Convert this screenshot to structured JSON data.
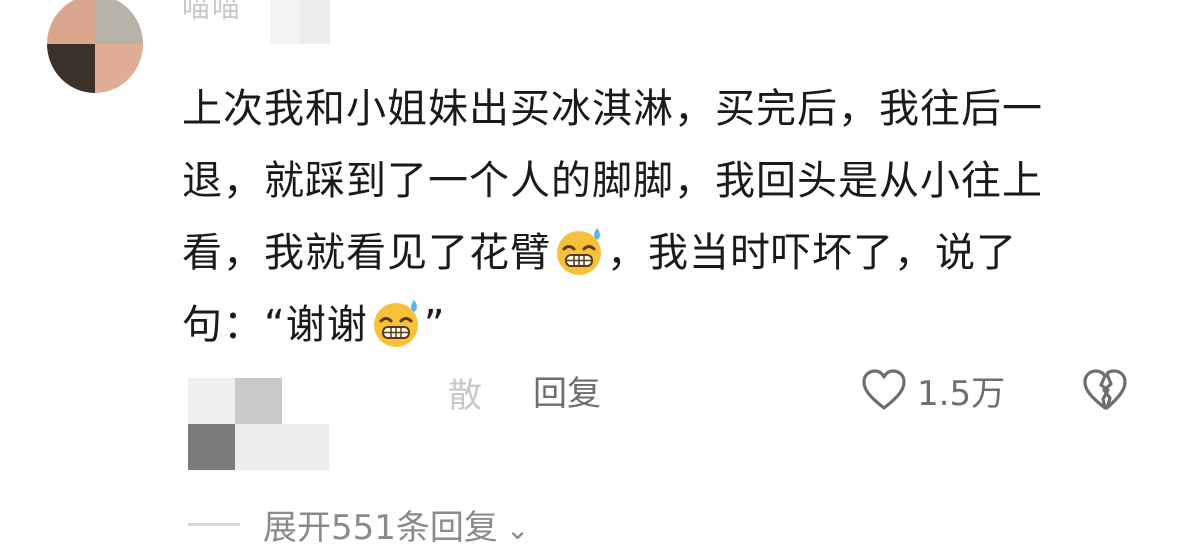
{
  "comment": {
    "username": "喵喵",
    "lines": [
      {
        "text": "上次我和小姐妹出买冰淇淋，买完后，我往后一"
      },
      {
        "text": "退，就踩到了一个人的脚脚，我回头是从小往上"
      },
      {
        "before": "看，我就看见了花臂",
        "emoji": "grinning-sweat-emoji",
        "after": "，我当时吓坏了，说了"
      },
      {
        "before": "句：“谢谢",
        "emoji": "grinning-sweat-emoji",
        "after": "”"
      }
    ]
  },
  "actions": {
    "hidden_label": "散",
    "reply_label": "回复",
    "like_icon": "heart-outline-icon",
    "like_count": "1.5万",
    "dislike_icon": "broken-heart-icon"
  },
  "expand": {
    "label": "展开551条回复",
    "icon": "chevron-down-icon"
  },
  "colors": {
    "text": "#1a1a1a",
    "secondary": "#6e6e6e",
    "muted": "#8a8a8a",
    "emoji_face": "#f7c23a",
    "emoji_sweat": "#5ab6ee"
  }
}
